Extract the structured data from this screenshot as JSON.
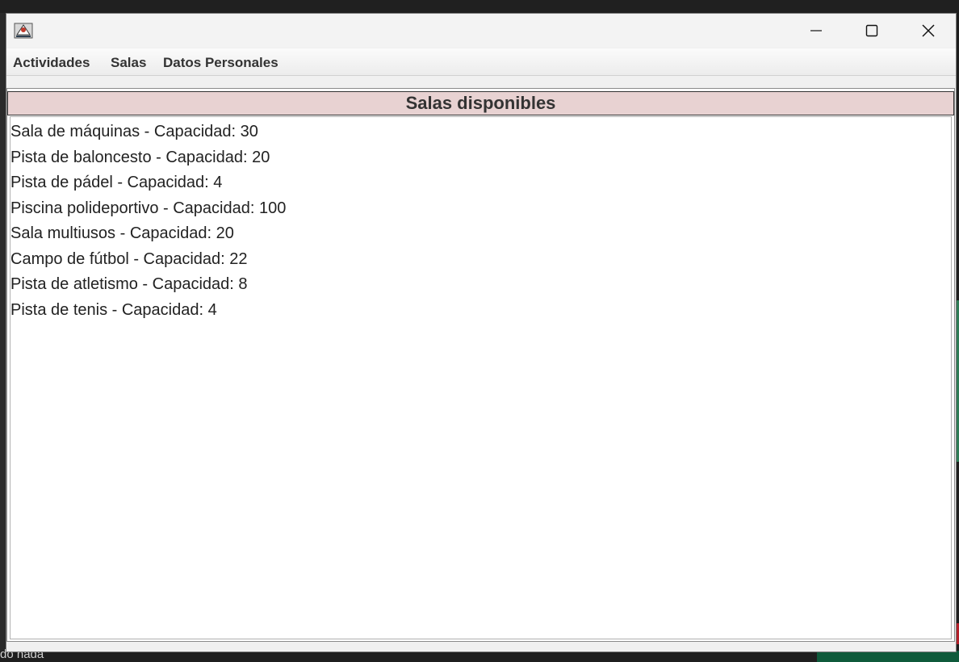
{
  "window": {
    "controls": {
      "minimize": "minimize-icon",
      "maximize": "maximize-icon",
      "close": "close-icon"
    }
  },
  "menu": {
    "items": [
      {
        "label": "Actividades"
      },
      {
        "label": "Salas"
      },
      {
        "label": "Datos Personales"
      }
    ]
  },
  "panel": {
    "title": "Salas disponibles",
    "items": [
      "Sala de máquinas - Capacidad: 30",
      "Pista de baloncesto - Capacidad: 20",
      "Pista de pádel - Capacidad: 4",
      "Piscina polideportivo - Capacidad: 100",
      "Sala multiusos - Capacidad: 20",
      "Campo de fútbol - Capacidad: 22",
      "Pista de atletismo - Capacidad: 8",
      "Pista de tenis - Capacidad: 4"
    ]
  },
  "background": {
    "bottom_text": "do nada"
  }
}
